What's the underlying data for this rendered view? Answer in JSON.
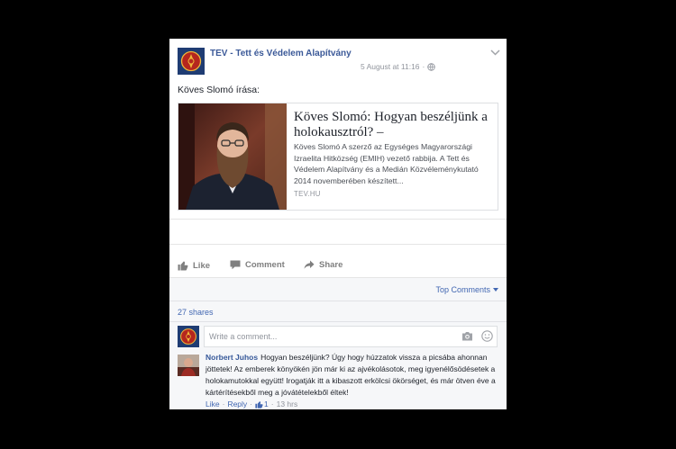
{
  "post": {
    "page_name": "TEV - Tett és Védelem Alapítvány",
    "timestamp": "5 August at 11:16",
    "separator": "·",
    "text": "Köves Slomó írása:",
    "link_preview": {
      "title": "Köves Slomó: Hogyan beszéljünk a holokausztról? –",
      "description": "Köves Slomó A szerző az Egységes Magyarországi Izraelita Hitközség (EMIH) vezető rabbija. A Tett és Védelem Alapítvány és a Medián Közvéleménykutató 2014 novemberében készített...",
      "domain": "TEV.HU"
    },
    "actions": {
      "like": "Like",
      "comment": "Comment",
      "share": "Share"
    },
    "top_comments_label": "Top Comments",
    "shares": "27 shares",
    "comment_box": {
      "placeholder": "Write a comment..."
    },
    "comments": [
      {
        "author": "Norbert Juhos",
        "text": "Hogyan beszéljünk? Úgy hogy húzzatok vissza a picsába ahonnan jöttetek! Az emberek könyökén jön már ki az ajvékolásotok, meg igyenélősödésetek a holokamutokkal együtt! Irogatják itt a kibaszott erkölcsi ökörséget, és már ötven éve a kártérítésekből meg a jóvátételekből éltek!",
        "like_label": "Like",
        "reply_label": "Reply",
        "like_count": "1",
        "time": "13 hrs"
      }
    ]
  },
  "colors": {
    "page_background": "#000000",
    "card_background": "#ffffff",
    "comments_background": "#f6f7f9",
    "page_name_blue": "#3b5998",
    "link_blue": "#4267b2",
    "text": "#1d2129",
    "muted": "#90949c",
    "border": "#dddfe2"
  },
  "icons": {
    "page_avatar": "tev-logo-icon",
    "privacy": "globe-icon",
    "post_menu": "chevron-down-icon",
    "like": "thumbs-up-icon",
    "comment": "comment-bubble-icon",
    "share": "share-arrow-icon",
    "top_comments_dropdown": "caret-down-icon",
    "attach_photo": "camera-icon",
    "emoji": "smiley-icon",
    "comment_like_count": "thumbs-up-icon"
  }
}
